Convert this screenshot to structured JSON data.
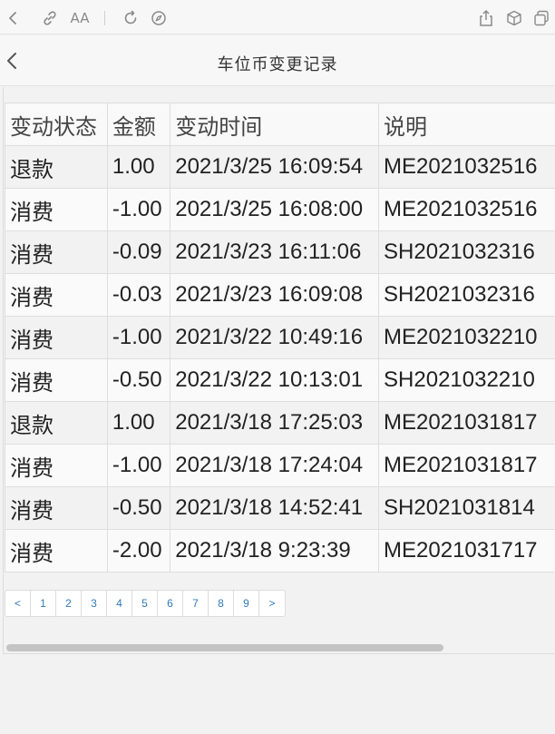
{
  "page": {
    "title": "车位币变更记录"
  },
  "table": {
    "headers": [
      "变动状态",
      "金额",
      "变动时间",
      "说明"
    ],
    "rows": [
      [
        "退款",
        "1.00",
        "2021/3/25 16:09:54",
        "ME2021032516"
      ],
      [
        "消费",
        "-1.00",
        "2021/3/25 16:08:00",
        "ME2021032516"
      ],
      [
        "消费",
        "-0.09",
        "2021/3/23 16:11:06",
        "SH2021032316"
      ],
      [
        "消费",
        "-0.03",
        "2021/3/23 16:09:08",
        "SH2021032316"
      ],
      [
        "消费",
        "-1.00",
        "2021/3/22 10:49:16",
        "ME2021032210"
      ],
      [
        "消费",
        "-0.50",
        "2021/3/22 10:13:01",
        "SH2021032210"
      ],
      [
        "退款",
        "1.00",
        "2021/3/18 17:25:03",
        "ME2021031817"
      ],
      [
        "消费",
        "-1.00",
        "2021/3/18 17:24:04",
        "ME2021031817"
      ],
      [
        "消费",
        "-0.50",
        "2021/3/18 14:52:41",
        "SH2021031814"
      ],
      [
        "消费",
        "-2.00",
        "2021/3/18 9:23:39",
        "ME2021031717"
      ]
    ]
  },
  "pagination": {
    "prev": "<",
    "pages": [
      "1",
      "2",
      "3",
      "4",
      "5",
      "6",
      "7",
      "8",
      "9"
    ],
    "next": ">"
  },
  "icons": {
    "toolbar_left": [
      "back-icon",
      "link-icon",
      "text-size-icon",
      "reload-icon",
      "compass-icon"
    ],
    "toolbar_right": [
      "share-icon",
      "box-icon",
      "tabs-icon"
    ],
    "text_size_glyph": "AA"
  },
  "colors": {
    "link": "#337ab7",
    "scrollbar": "#c4c4c4"
  }
}
